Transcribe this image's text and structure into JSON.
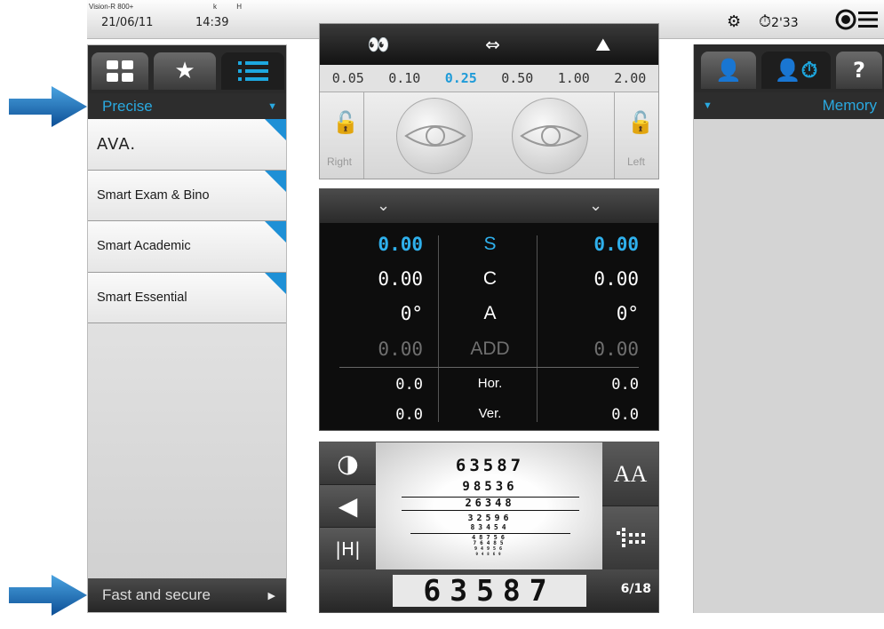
{
  "topbar": {
    "device": "Vision-R 800+",
    "kh": "k H",
    "date": "21/06/11",
    "time": "14:39",
    "timer": "2'33"
  },
  "left_panel": {
    "mode_label": "Precise",
    "programs": [
      {
        "label": "AVA."
      },
      {
        "label": "Smart Exam & Bino"
      },
      {
        "label": "Smart Academic"
      },
      {
        "label": "Smart Essential"
      }
    ],
    "bottom_label": "Fast and secure"
  },
  "vision": {
    "acuity_values": [
      "0.05",
      "0.10",
      "0.25",
      "0.50",
      "1.00",
      "2.00"
    ],
    "selected_acuity": "0.25",
    "right_label": "Right",
    "left_label": "Left"
  },
  "refraction": {
    "rows": [
      {
        "left": "0.00",
        "label": "S",
        "right": "0.00"
      },
      {
        "left": "0.00",
        "label": "C",
        "right": "0.00"
      },
      {
        "left": "0°",
        "label": "A",
        "right": "0°"
      },
      {
        "left": "0.00",
        "label": "ADD",
        "right": "0.00"
      },
      {
        "left": "0.0",
        "label": "Hor.",
        "right": "0.0"
      },
      {
        "left": "0.0",
        "label": "Ver.",
        "right": "0.0"
      }
    ]
  },
  "chart": {
    "lines": [
      "63587",
      "98536",
      "26348",
      "32596",
      "83454",
      "48756",
      "76485",
      "94956",
      "94869"
    ],
    "current": "63587",
    "page": "6/18",
    "font_button": "AA"
  },
  "right_panel": {
    "help_label": "?",
    "memory_label": "Memory"
  }
}
